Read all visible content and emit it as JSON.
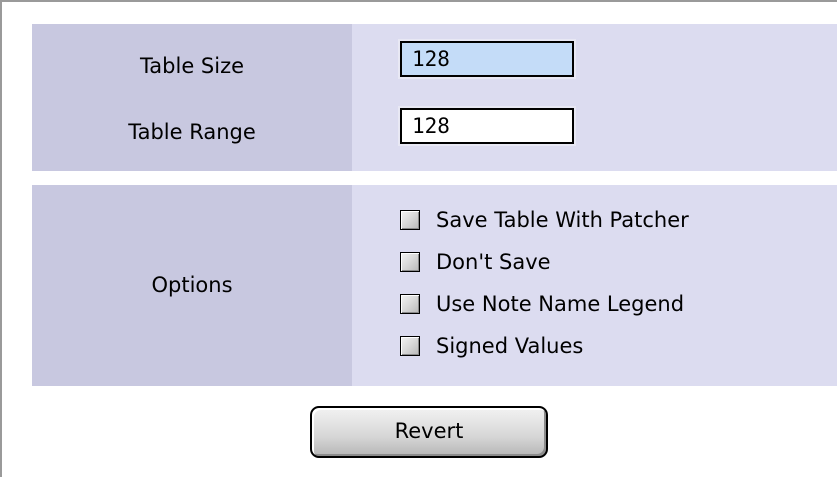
{
  "table_size": {
    "label": "Table Size",
    "value": "128"
  },
  "table_range": {
    "label": "Table Range",
    "value": "128"
  },
  "options": {
    "label": "Options",
    "items": [
      {
        "label": "Save Table With Patcher",
        "checked": false
      },
      {
        "label": "Don't Save",
        "checked": false
      },
      {
        "label": "Use Note Name Legend",
        "checked": false
      },
      {
        "label": "Signed Values",
        "checked": false
      }
    ]
  },
  "revert_button": {
    "label": "Revert"
  },
  "colors": {
    "label_column_bg": "#c8c8e0",
    "value_column_bg": "#dcdcf0",
    "focused_field_bg": "#c4dcf8"
  }
}
